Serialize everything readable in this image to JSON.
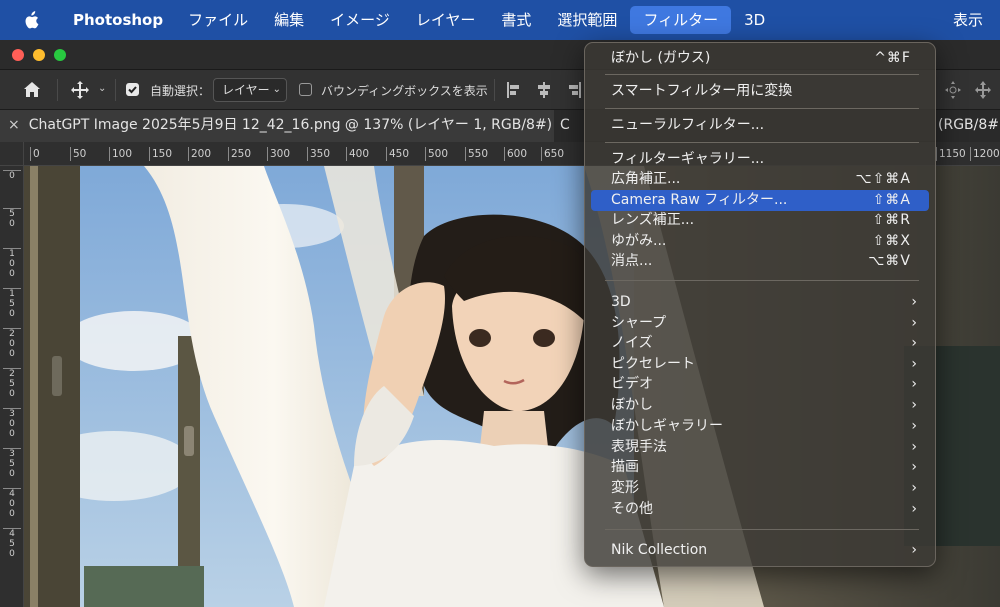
{
  "colors": {
    "menubar": "#1f50a5",
    "menu_active": "#3f78e0",
    "menu_highlight": "#2f5fc8",
    "traffic_red": "#ff5f57",
    "traffic_yellow": "#febc2e",
    "traffic_green": "#28c840"
  },
  "menubar": {
    "apple_icon": "apple-logo",
    "items": [
      "Photoshop",
      "ファイル",
      "編集",
      "イメージ",
      "レイヤー",
      "書式",
      "選択範囲",
      "フィルター",
      "3D"
    ],
    "active": "フィルター",
    "right": "表示"
  },
  "options_bar": {
    "home_icon": "home-icon",
    "move_icon": "move-tool-icon",
    "auto_select_label": "自動選択：",
    "auto_select_checked": true,
    "auto_select_value": "レイヤー",
    "bounding_box_label": "バウンディングボックスを表示",
    "bounding_box_checked": false
  },
  "tabs": {
    "active_tab": "ChatGPT Image 2025年5月9日 12_42_16.png @ 137% (レイヤー 1, RGB/8#) *",
    "second_tab_fragment": "C",
    "right_fragment": "(RGB/8#)"
  },
  "ruler_h": [
    "0",
    "50",
    "100",
    "150",
    "200",
    "250",
    "300",
    "350",
    "400",
    "450",
    "500",
    "550",
    "600",
    "650",
    "1150",
    "1200"
  ],
  "ruler_v": [
    "0",
    "5\n0",
    "1\n0\n0",
    "1\n5\n0",
    "2\n0\n0",
    "2\n5\n0",
    "3\n0\n0",
    "3\n5\n0",
    "4\n0\n0",
    "4\n5\n0"
  ],
  "filter_menu": {
    "items": [
      {
        "label": "ぼかし (ガウス)",
        "shortcut": "^⌘F"
      },
      {
        "label": "スマートフィルター用に変換",
        "shortcut": ""
      },
      {
        "label": "ニューラルフィルター...",
        "shortcut": ""
      },
      {
        "label": "フィルターギャラリー...",
        "shortcut": ""
      },
      {
        "label": "広角補正...",
        "shortcut": "⌥⇧⌘A"
      },
      {
        "label": "Camera Raw フィルター...",
        "shortcut": "⇧⌘A"
      },
      {
        "label": "レンズ補正...",
        "shortcut": "⇧⌘R"
      },
      {
        "label": "ゆがみ...",
        "shortcut": "⇧⌘X"
      },
      {
        "label": "消点...",
        "shortcut": "⌥⌘V"
      },
      {
        "label": "3D",
        "shortcut": "›"
      },
      {
        "label": "シャープ",
        "shortcut": "›"
      },
      {
        "label": "ノイズ",
        "shortcut": "›"
      },
      {
        "label": "ピクセレート",
        "shortcut": "›"
      },
      {
        "label": "ビデオ",
        "shortcut": "›"
      },
      {
        "label": "ぼかし",
        "shortcut": "›"
      },
      {
        "label": "ぼかしギャラリー",
        "shortcut": "›"
      },
      {
        "label": "表現手法",
        "shortcut": "›"
      },
      {
        "label": "描画",
        "shortcut": "›"
      },
      {
        "label": "変形",
        "shortcut": "›"
      },
      {
        "label": "その他",
        "shortcut": "›"
      },
      {
        "label": "Nik Collection",
        "shortcut": "›"
      }
    ],
    "highlighted": "Camera Raw フィルター..."
  }
}
